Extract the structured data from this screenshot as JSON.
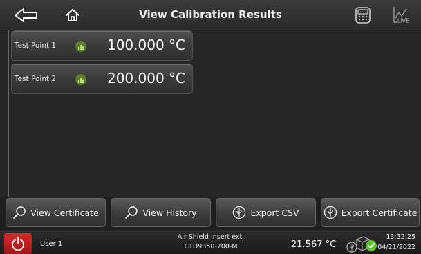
{
  "header": {
    "title": "View Calibration Results",
    "back_icon": "back-arrow-icon",
    "home_icon": "home-icon",
    "calculator_icon": "calculator-icon",
    "live_icon": "live-chart-icon",
    "live_label": "LIVE"
  },
  "test_points": [
    {
      "label": "Test Point 1",
      "value": "100.000 °C",
      "icon": "bar-chart-icon"
    },
    {
      "label": "Test Point 2",
      "value": "200.000 °C",
      "icon": "bar-chart-icon"
    }
  ],
  "actions": [
    {
      "label": "View Certificate",
      "icon": "magnifier-icon"
    },
    {
      "label": "View History",
      "icon": "magnifier-icon"
    },
    {
      "label": "Export CSV",
      "icon": "usb-icon"
    },
    {
      "label": "Export Certificate",
      "icon": "usb-icon"
    }
  ],
  "status": {
    "power_icon": "power-icon",
    "user": "User 1",
    "probe_line1": "Air Shield Insert ext.",
    "probe_line2": "CTD9350-700-M",
    "temperature": "21.567 °C",
    "time": "13:32:25",
    "date": "04/21/2022",
    "status_color": "#5cc42a"
  },
  "colors": {
    "power": "#c81f1f",
    "indicator": "#5f7d2c"
  }
}
